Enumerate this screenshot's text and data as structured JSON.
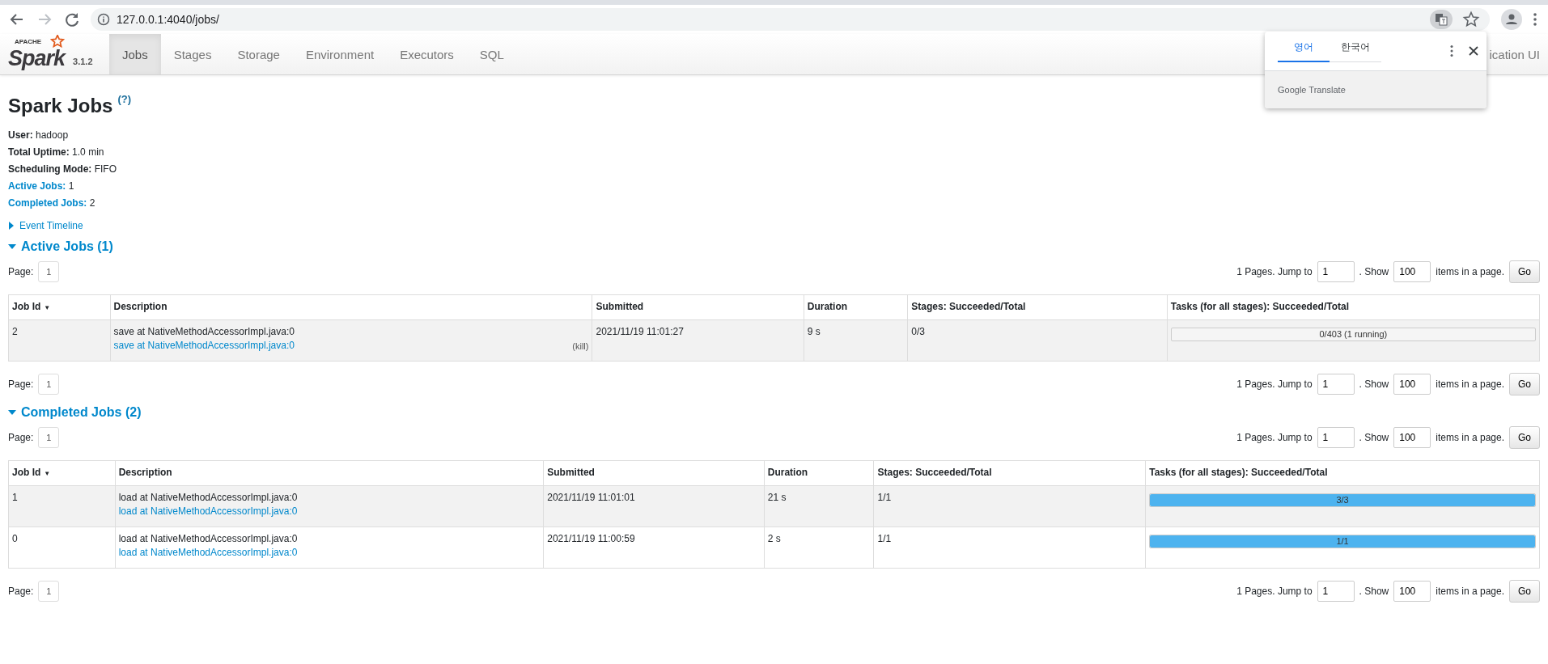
{
  "browser": {
    "url": "127.0.0.1:4040/jobs/"
  },
  "nav": {
    "logo_small": "APACHE",
    "logo_word": "Spark",
    "version": "3.1.2",
    "tabs": [
      {
        "label": "Jobs",
        "selected": true
      },
      {
        "label": "Stages",
        "selected": false
      },
      {
        "label": "Storage",
        "selected": false
      },
      {
        "label": "Environment",
        "selected": false
      },
      {
        "label": "Executors",
        "selected": false
      },
      {
        "label": "SQL",
        "selected": false
      }
    ],
    "app_name": "ication UI"
  },
  "translate_popup": {
    "tabs": [
      {
        "label": "영어",
        "selected": true
      },
      {
        "label": "한국어",
        "selected": false
      }
    ],
    "footer": "Google Translate"
  },
  "header": {
    "title": "Spark Jobs",
    "help": "(?)"
  },
  "summary": [
    {
      "kind": "plain",
      "text": "**User:** hadoop"
    },
    {
      "kind": "plain",
      "text": "**Total Uptime:** 1.0 min"
    },
    {
      "kind": "plain",
      "text": "**Scheduling Mode:** FIFO"
    },
    {
      "kind": "link",
      "text": "**Active Jobs:** 1"
    },
    {
      "kind": "link",
      "text": "**Completed Jobs:** 2"
    }
  ],
  "event_timeline": {
    "label": "Event Timeline",
    "expanded": false
  },
  "sections": [
    {
      "title": "Active Jobs (1)",
      "expanded": true,
      "pager_top": {
        "page_label": "Page:",
        "page": "1",
        "pages_text": "1 Pages. Jump to",
        "jump": "1",
        "show_text": ". Show",
        "show": "100",
        "items_text": "items in a page.",
        "go": "Go"
      },
      "columns": [
        {
          "label": "Job Id",
          "sort": "▼"
        },
        {
          "label": "Description"
        },
        {
          "label": "Submitted"
        },
        {
          "label": "Duration"
        },
        {
          "label": "Stages: Succeeded/Total"
        },
        {
          "label": "Tasks (for all stages): Succeeded/Total"
        }
      ],
      "rows": [
        {
          "job_id": "2",
          "description": "save at NativeMethodAccessorImpl.java:0",
          "description_link": "save at NativeMethodAccessorImpl.java:0",
          "kill": "(kill)",
          "submitted": "2021/11/19 11:01:27",
          "duration": "9 s",
          "stages": "0/3",
          "tasks": {
            "label": "0/403 (1 running)",
            "level": 0
          }
        }
      ],
      "pager_bottom": {
        "page_label": "Page:",
        "page": "1",
        "pages_text": "1 Pages. Jump to",
        "jump": "1",
        "show_text": ". Show",
        "show": "100",
        "items_text": "items in a page.",
        "go": "Go"
      }
    },
    {
      "title": "Completed Jobs (2)",
      "expanded": true,
      "pager_top": {
        "page_label": "Page:",
        "page": "1",
        "pages_text": "1 Pages. Jump to",
        "jump": "1",
        "show_text": ". Show",
        "show": "100",
        "items_text": "items in a page.",
        "go": "Go"
      },
      "columns": [
        {
          "label": "Job Id",
          "sort": "▼"
        },
        {
          "label": "Description"
        },
        {
          "label": "Submitted"
        },
        {
          "label": "Duration"
        },
        {
          "label": "Stages: Succeeded/Total"
        },
        {
          "label": "Tasks (for all stages): Succeeded/Total"
        }
      ],
      "rows": [
        {
          "job_id": "1",
          "description": "load at NativeMethodAccessorImpl.java:0",
          "description_link": "load at NativeMethodAccessorImpl.java:0",
          "submitted": "2021/11/19 11:01:01",
          "duration": "21 s",
          "stages": "1/1",
          "tasks": {
            "label": "3/3",
            "level": 1
          }
        },
        {
          "job_id": "0",
          "description": "load at NativeMethodAccessorImpl.java:0",
          "description_link": "load at NativeMethodAccessorImpl.java:0",
          "submitted": "2021/11/19 11:00:59",
          "duration": "2 s",
          "stages": "1/1",
          "tasks": {
            "label": "1/1",
            "level": 1
          }
        }
      ],
      "pager_bottom": {
        "page_label": "Page:",
        "page": "1",
        "pages_text": "1 Pages. Jump to",
        "jump": "1",
        "show_text": ". Show",
        "show": "100",
        "items_text": "items in a page.",
        "go": "Go"
      }
    }
  ]
}
